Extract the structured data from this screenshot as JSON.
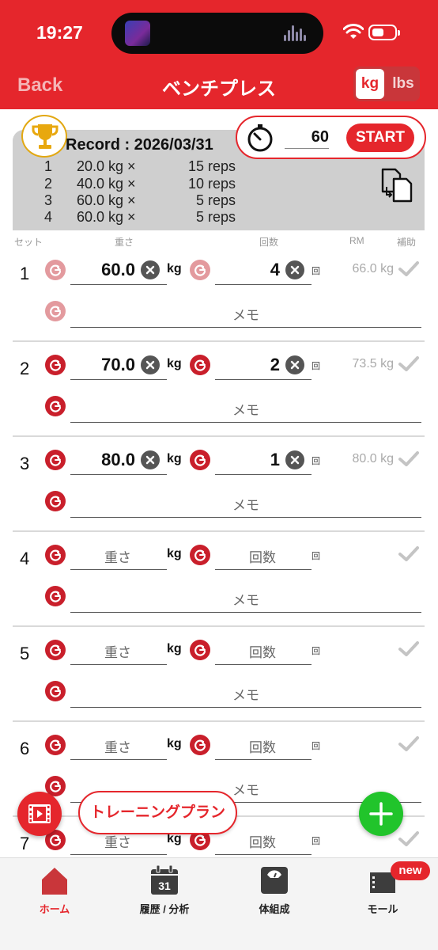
{
  "status": {
    "time": "19:27"
  },
  "nav": {
    "back": "Back",
    "title": "ベンチプレス",
    "unit_kg": "kg",
    "unit_lbs": "lbs"
  },
  "record": {
    "title": "Record : 2026/03/31",
    "rows": [
      {
        "n": "1",
        "weight": "20.0 kg ×",
        "reps": "15 reps"
      },
      {
        "n": "2",
        "weight": "40.0 kg ×",
        "reps": "10 reps"
      },
      {
        "n": "3",
        "weight": "60.0 kg ×",
        "reps": "5 reps"
      },
      {
        "n": "4",
        "weight": "60.0 kg ×",
        "reps": "5 reps"
      }
    ]
  },
  "timer": {
    "seconds": "60",
    "start": "START"
  },
  "headers": {
    "set": "セット",
    "weight": "重さ",
    "reps": "回数",
    "rm": "RM",
    "assist": "補助"
  },
  "sets": [
    {
      "num": "1",
      "weight": "60.0",
      "reps": "4",
      "rm": "66.0 kg",
      "filled": true,
      "faded": true
    },
    {
      "num": "2",
      "weight": "70.0",
      "reps": "2",
      "rm": "73.5 kg",
      "filled": true,
      "faded": false
    },
    {
      "num": "3",
      "weight": "80.0",
      "reps": "1",
      "rm": "80.0 kg",
      "filled": true,
      "faded": false
    },
    {
      "num": "4",
      "filled": false
    },
    {
      "num": "5",
      "filled": false
    },
    {
      "num": "6",
      "filled": false
    },
    {
      "num": "7",
      "filled": false
    }
  ],
  "labels": {
    "kg": "kg",
    "kai": "回",
    "weight_placeholder": "重さ",
    "reps_placeholder": "回数",
    "memo_placeholder": "メモ"
  },
  "plan_button": "トレーニングプラン",
  "tabs": [
    {
      "label": "ホーム",
      "icon": "home-icon",
      "active": true
    },
    {
      "label": "履歴 / 分析",
      "icon": "calendar-icon",
      "calendar_day": "31",
      "active": false
    },
    {
      "label": "体組成",
      "icon": "scale-icon",
      "active": false
    },
    {
      "label": "モール",
      "icon": "shop-icon",
      "active": false
    }
  ],
  "badge_new": "new",
  "colors": {
    "accent": "#e5262c",
    "add": "#21c42b",
    "record_bg": "#cfcfcf"
  }
}
